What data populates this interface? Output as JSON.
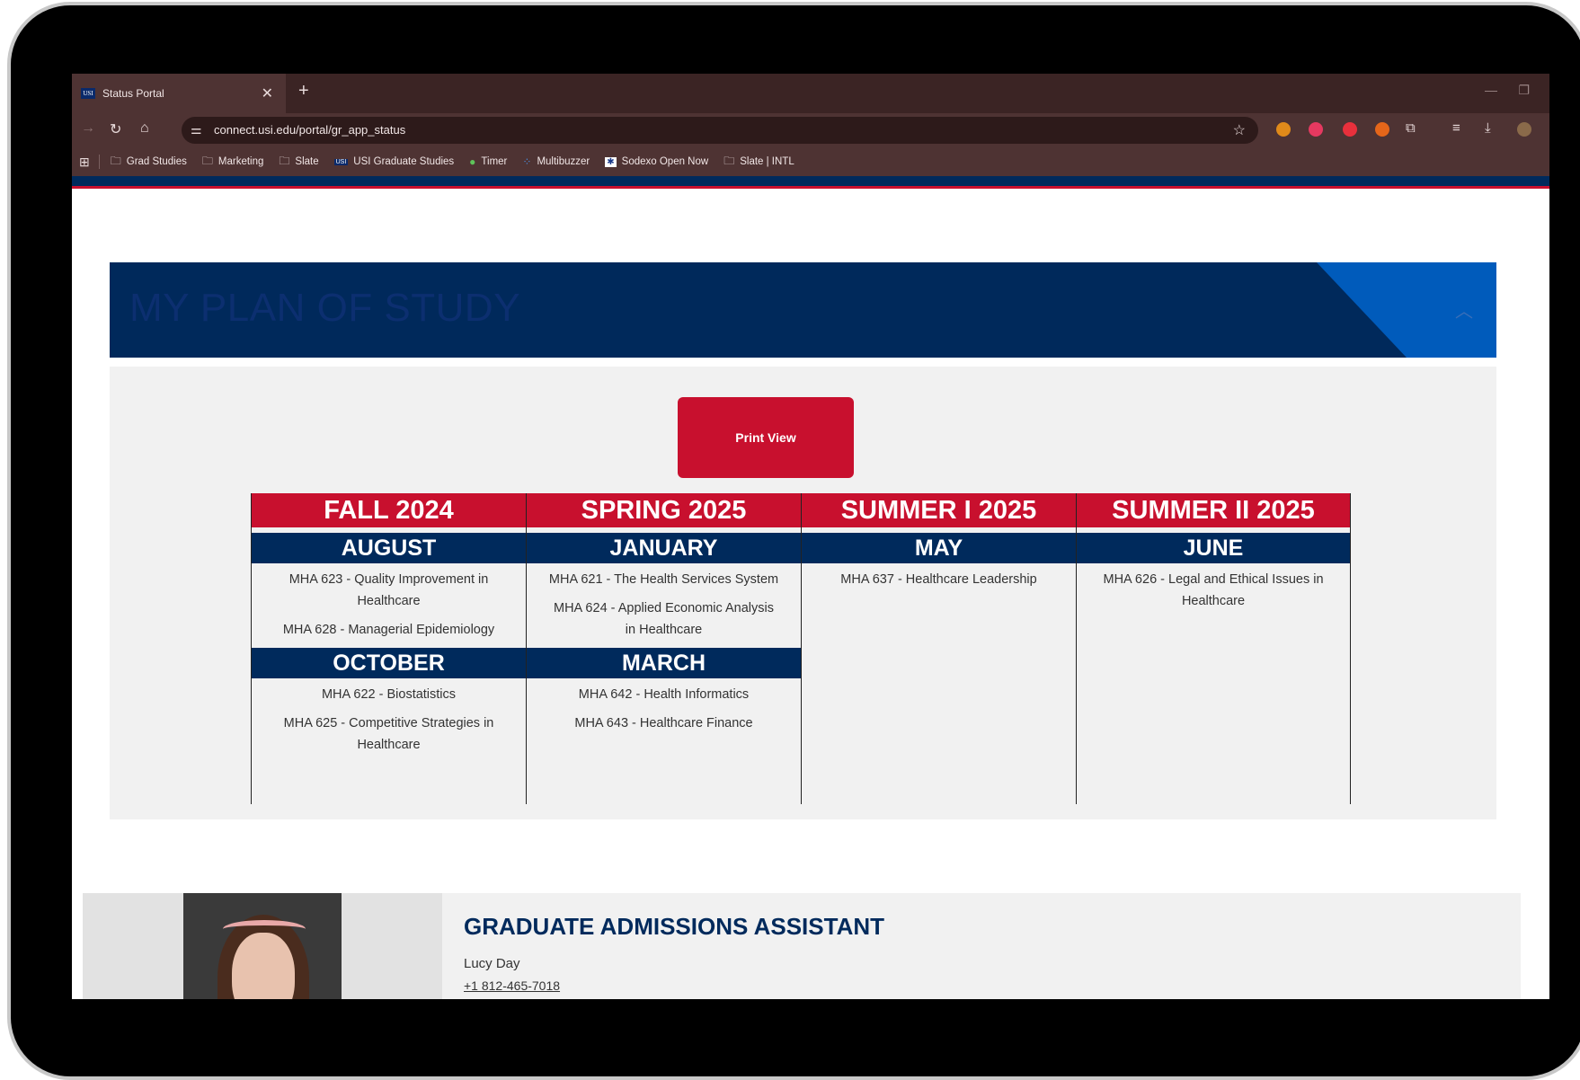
{
  "browser": {
    "tab_title": "Status Portal",
    "tab_favicon_text": "USI",
    "new_tab": "+",
    "url": "connect.usi.edu/portal/gr_app_status",
    "bookmarks": [
      {
        "label": "Grad Studies",
        "icon": "folder-icon"
      },
      {
        "label": "Marketing",
        "icon": "folder-icon"
      },
      {
        "label": "Slate",
        "icon": "folder-icon"
      },
      {
        "label": "USI Graduate Studies",
        "icon": "usi-logo-icon"
      },
      {
        "label": "Timer",
        "icon": "timer-icon"
      },
      {
        "label": "Multibuzzer",
        "icon": "multibuzzer-icon"
      },
      {
        "label": "Sodexo Open Now",
        "icon": "sodexo-icon"
      },
      {
        "label": "Slate | INTL",
        "icon": "folder-icon"
      }
    ]
  },
  "plan": {
    "title": "MY PLAN OF STUDY",
    "print_label": "Print View",
    "terms": [
      {
        "name": "FALL 2024",
        "blocks": [
          {
            "month": "AUGUST",
            "courses": [
              "MHA 623 - Quality Improvement in Healthcare",
              "MHA 628 - Managerial Epidemiology"
            ]
          },
          {
            "month": "OCTOBER",
            "courses": [
              "MHA 622 - Biostatistics",
              "MHA 625 - Competitive Strategies in Healthcare"
            ]
          }
        ]
      },
      {
        "name": "SPRING 2025",
        "blocks": [
          {
            "month": "JANUARY",
            "courses": [
              "MHA 621 - The Health Services System",
              "MHA 624 - Applied Economic Analysis in Healthcare"
            ]
          },
          {
            "month": "MARCH",
            "courses": [
              "MHA 642 - Health Informatics",
              "MHA 643 - Healthcare Finance"
            ]
          }
        ]
      },
      {
        "name": "SUMMER I 2025",
        "blocks": [
          {
            "month": "MAY",
            "courses": [
              "MHA 637 - Healthcare Leadership"
            ]
          }
        ]
      },
      {
        "name": "SUMMER II 2025",
        "blocks": [
          {
            "month": "JUNE",
            "courses": [
              "MHA 626 - Legal and Ethical Issues in Healthcare"
            ]
          }
        ]
      }
    ]
  },
  "contact": {
    "role": "GRADUATE ADMISSIONS ASSISTANT",
    "name": "Lucy Day",
    "phone": "+1 812-465-7018"
  },
  "colors": {
    "usi_red": "#c8102e",
    "usi_navy": "#002a5c",
    "usi_blue": "#005bbb"
  }
}
